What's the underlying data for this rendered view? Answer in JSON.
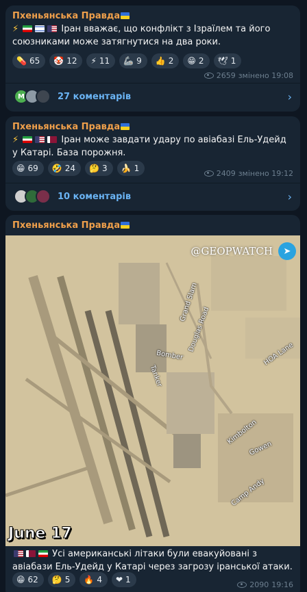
{
  "posts": [
    {
      "channel": "Пхеньянська Правда",
      "text": "Іран вважає, що конфлікт з Ізраїлем та його союзниками може затягнутися на два роки.",
      "reactions": [
        {
          "emoji": "💊",
          "count": "65"
        },
        {
          "emoji": "🤡",
          "count": "12"
        },
        {
          "emoji": "⚡",
          "count": "11"
        },
        {
          "emoji": "🦾",
          "count": "9"
        },
        {
          "emoji": "👍",
          "count": "2"
        },
        {
          "emoji": "😁",
          "count": "2"
        },
        {
          "emoji": "🕊",
          "count": "1"
        }
      ],
      "views": "2659",
      "time": "змінено 19:08",
      "comments": "27 коментарів"
    },
    {
      "channel": "Пхеньянська Правда",
      "text": "Іран може завдати удару по авіабазі Ель-Удейд у Катарі. База порожня.",
      "reactions": [
        {
          "emoji": "😁",
          "count": "69"
        },
        {
          "emoji": "🤣",
          "count": "24"
        },
        {
          "emoji": "🤔",
          "count": "3"
        },
        {
          "emoji": "🍌",
          "count": "1"
        }
      ],
      "views": "2409",
      "time": "змінено 19:12",
      "comments": "10 коментарів"
    },
    {
      "channel": "Пхеньянська Правда",
      "text": "Усі американські літаки були евакуйовані з авіабази Ель-Удейд у Катарі через загрозу іранської атаки.",
      "reactions": [
        {
          "emoji": "😁",
          "count": "62"
        },
        {
          "emoji": "🤔",
          "count": "5"
        },
        {
          "emoji": "🔥",
          "count": "4"
        },
        {
          "emoji": "❤",
          "count": "1"
        }
      ],
      "views": "2090",
      "time": "19:16",
      "map": {
        "watermark": "@GEOPWATCH",
        "date": "June 17",
        "labels": {
          "grand_slam": "Grand Slam",
          "douglas_road": "Douglas Road",
          "bomber": "Bomber",
          "tanker": "Tanker",
          "hoa_lane": "HOA Lane",
          "kimbolton": "Kimbolton",
          "gowen": "Gowen",
          "camp_andy": "Camp Andy"
        }
      }
    }
  ],
  "icons": {
    "eye": "eye-icon",
    "chevron": "chevron-right-icon",
    "telegram": "telegram-icon"
  },
  "colors": {
    "background": "#0e1621",
    "bubble": "#182533",
    "channel_name": "#f0a04b",
    "link": "#6ab3f3"
  }
}
